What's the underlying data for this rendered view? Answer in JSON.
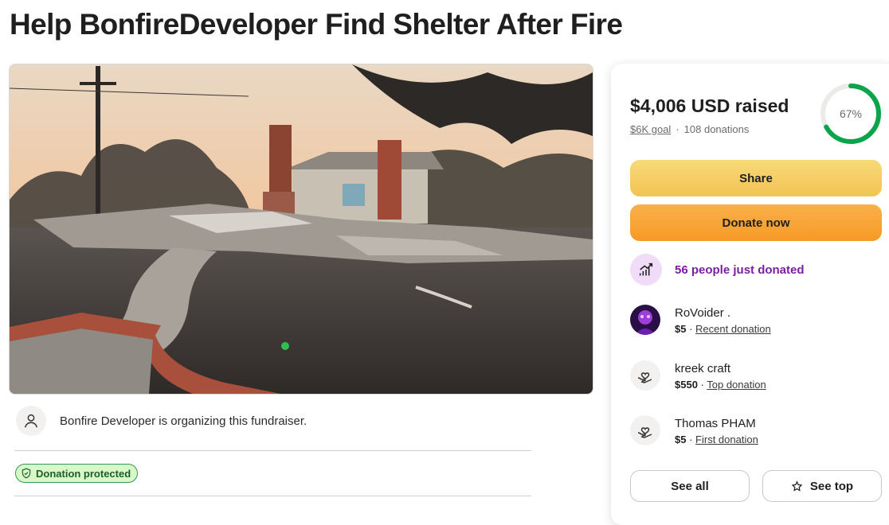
{
  "page_title": "Help BonfireDeveloper Find Shelter After Fire",
  "organizer": {
    "text": "Bonfire Developer is organizing this fundraiser.",
    "icon": "user-icon"
  },
  "badge": {
    "label": "Donation protected",
    "icon": "shield-check-icon"
  },
  "stats": {
    "raised": "$4,006 USD raised",
    "goal": "$6K goal",
    "separator": "·",
    "donations": "108 donations",
    "progress_label": "67%",
    "progress_fraction": 0.67
  },
  "buttons": {
    "share": "Share",
    "donate": "Donate now",
    "see_all": "See all",
    "see_top": "See top"
  },
  "trend": {
    "text": "56 people just donated",
    "icon": "trending-up-icon"
  },
  "donors": [
    {
      "name": "RoVoider .",
      "amount": "$5",
      "sep": " · ",
      "tag": "Recent donation",
      "avatar": "profile-photo"
    },
    {
      "name": "kreek craft",
      "amount": "$550",
      "sep": " · ",
      "tag": "Top donation",
      "avatar": "heart-hand-icon"
    },
    {
      "name": "Thomas PHAM",
      "amount": "$5",
      "sep": " · ",
      "tag": "First donation",
      "avatar": "heart-hand-icon"
    }
  ],
  "colors": {
    "progress": "#0ca44a",
    "trend_text": "#7b1fa2",
    "share_button": "#f2c352",
    "donate_button": "#f59a25",
    "badge_bg": "#d9f7c7",
    "badge_border": "#2f9c55"
  }
}
